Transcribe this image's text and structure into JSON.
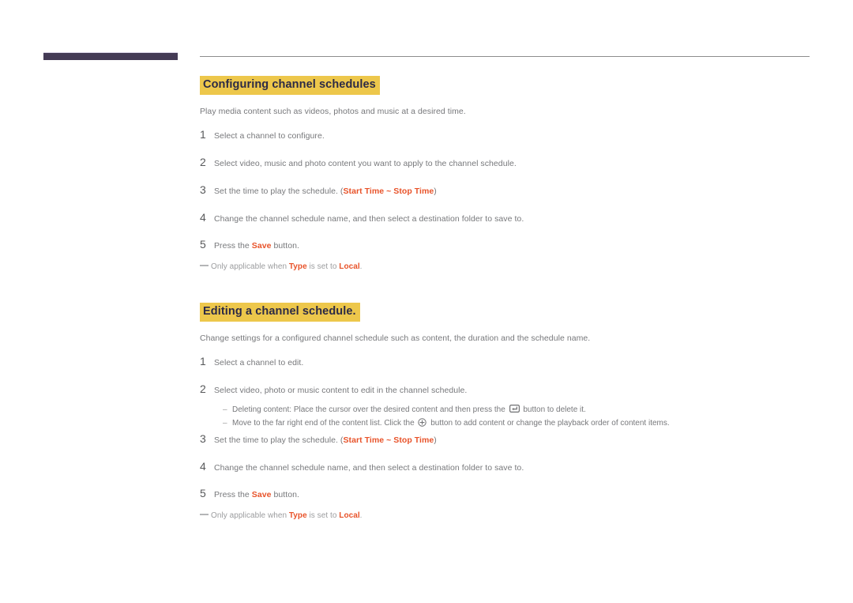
{
  "page": {
    "accent_highlight": "#edc74b",
    "heading_text_color": "#2c2a45",
    "keyword_color": "#e8532a",
    "body_text_color": "#77787b",
    "header_bar_color": "#443b55"
  },
  "sections": [
    {
      "heading": "Configuring channel schedules",
      "lead": "Play media content such as videos, photos and music at a desired time.",
      "steps": [
        {
          "num": "1",
          "parts": [
            {
              "type": "text",
              "value": "Select a channel to configure."
            }
          ]
        },
        {
          "num": "2",
          "parts": [
            {
              "type": "text",
              "value": "Select video, music and photo content you want to apply to the channel schedule."
            }
          ]
        },
        {
          "num": "3",
          "parts": [
            {
              "type": "text",
              "value": "Set the time to play the schedule. ("
            },
            {
              "type": "kw",
              "value": "Start Time"
            },
            {
              "type": "kw",
              "value": " ~ "
            },
            {
              "type": "kw",
              "value": "Stop Time"
            },
            {
              "type": "text",
              "value": ")"
            }
          ]
        },
        {
          "num": "4",
          "parts": [
            {
              "type": "text",
              "value": "Change the channel schedule name, and then select a destination folder to save to."
            }
          ]
        },
        {
          "num": "5",
          "parts": [
            {
              "type": "text",
              "value": "Press the "
            },
            {
              "type": "kw",
              "value": "Save"
            },
            {
              "type": "text",
              "value": " button."
            }
          ]
        }
      ],
      "note": {
        "prefix": "Only applicable when ",
        "kw1": "Type",
        "middle": " is set to ",
        "kw2": "Local",
        "suffix": "."
      }
    },
    {
      "heading": "Editing a channel schedule.",
      "lead": "Change settings for a configured channel schedule such as content, the duration and the schedule name.",
      "steps": [
        {
          "num": "1",
          "parts": [
            {
              "type": "text",
              "value": "Select a channel to edit."
            }
          ]
        },
        {
          "num": "2",
          "parts": [
            {
              "type": "text",
              "value": "Select video, photo or music content to edit in the channel schedule."
            }
          ],
          "subbullets": [
            {
              "dash": "–",
              "before": "Deleting content: Place the cursor over the desired content and then press the ",
              "icon": "enter-key-icon",
              "after": " button to delete it."
            },
            {
              "dash": "–",
              "before": "Move to the far right end of the content list. Click the ",
              "icon": "plus-circle-icon",
              "after": " button to add content or change the playback order of content items."
            }
          ]
        },
        {
          "num": "3",
          "parts": [
            {
              "type": "text",
              "value": "Set the time to play the schedule. ("
            },
            {
              "type": "kw",
              "value": "Start Time"
            },
            {
              "type": "kw",
              "value": " ~ "
            },
            {
              "type": "kw",
              "value": "Stop Time"
            },
            {
              "type": "text",
              "value": ")"
            }
          ]
        },
        {
          "num": "4",
          "parts": [
            {
              "type": "text",
              "value": "Change the channel schedule name, and then select a destination folder to save to."
            }
          ]
        },
        {
          "num": "5",
          "parts": [
            {
              "type": "text",
              "value": "Press the "
            },
            {
              "type": "kw",
              "value": "Save"
            },
            {
              "type": "text",
              "value": " button."
            }
          ]
        }
      ],
      "note": {
        "prefix": "Only applicable when ",
        "kw1": "Type",
        "middle": " is set to ",
        "kw2": "Local",
        "suffix": "."
      }
    }
  ]
}
